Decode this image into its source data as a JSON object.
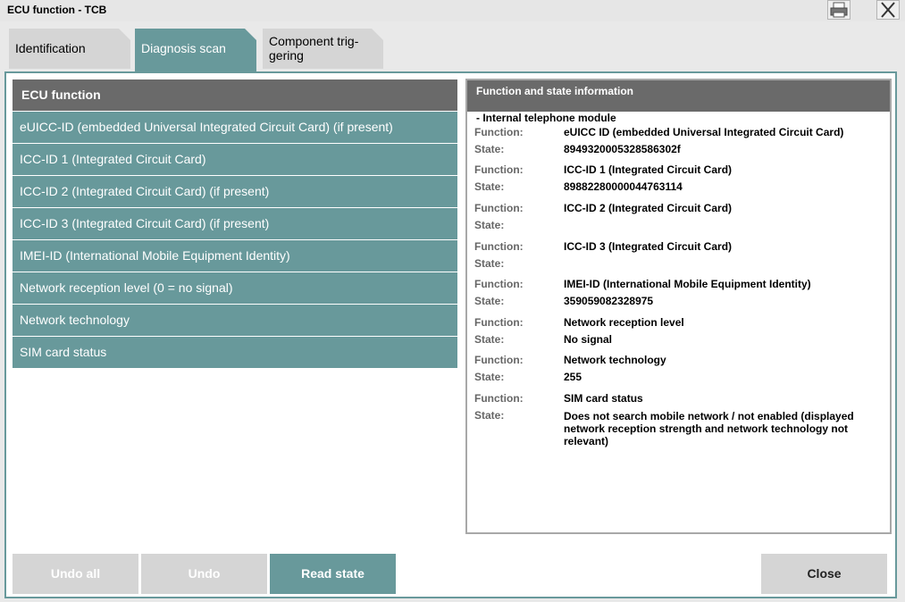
{
  "window": {
    "title": "ECU function - TCB",
    "print_icon": "printer-icon",
    "close_icon": "close-icon"
  },
  "tabs": [
    {
      "label": "Identification",
      "active": false
    },
    {
      "label": "Diagnosis scan",
      "active": true
    },
    {
      "label": "Component trig-\ngering",
      "active": false
    }
  ],
  "ecu_list": {
    "header": "ECU function",
    "items": [
      "eUICC-ID (embedded Universal Integrated Circuit Card) (if present)",
      "ICC-ID 1 (Integrated Circuit Card)",
      "ICC-ID 2 (Integrated Circuit Card) (if present)",
      "ICC-ID 3 (Integrated Circuit Card) (if present)",
      "IMEI-ID (International Mobile Equipment Identity)",
      "Network reception level (0 = no signal)",
      "Network technology",
      "SIM card status"
    ]
  },
  "info": {
    "header": "Function and state information",
    "module": "- Internal telephone module",
    "function_label": "Function:",
    "state_label": "State:",
    "entries": [
      {
        "function": "eUICC ID (embedded Universal Integrated Circuit Card)",
        "state": "8949320005328586302f"
      },
      {
        "function": "ICC-ID 1 (Integrated Circuit Card)",
        "state": "89882280000044763114"
      },
      {
        "function": "ICC-ID 2 (Integrated Circuit Card)",
        "state": ""
      },
      {
        "function": "ICC-ID 3 (Integrated Circuit Card)",
        "state": ""
      },
      {
        "function": "IMEI-ID (International Mobile Equipment Identity)",
        "state": "359059082328975"
      },
      {
        "function": "Network reception level",
        "state": "No signal"
      },
      {
        "function": "Network technology",
        "state": "255"
      },
      {
        "function": "SIM card status",
        "state": "Does not search mobile network / not enabled (displayed network reception strength and network technology not relevant)"
      }
    ]
  },
  "buttons": {
    "undo_all": "Undo all",
    "undo": "Undo",
    "read_state": "Read state",
    "close": "Close"
  },
  "colors": {
    "accent": "#68999b",
    "header_gray": "#6a6a6a",
    "disabled_gray": "#d5d5d5"
  }
}
